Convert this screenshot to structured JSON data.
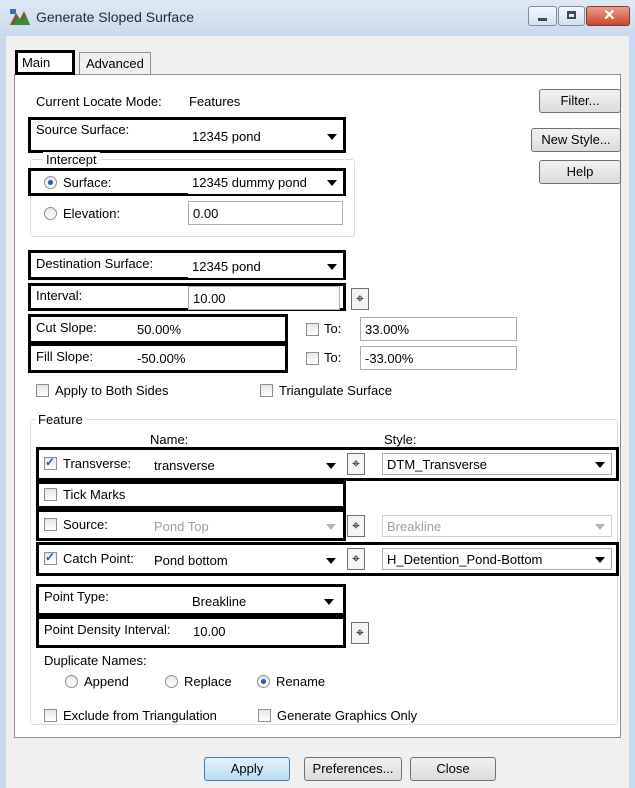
{
  "window": {
    "title": "Generate Sloped Surface"
  },
  "tabs": [
    {
      "label": "Main"
    },
    {
      "label": "Advanced"
    }
  ],
  "locate": {
    "label": "Current Locate Mode:",
    "value": "Features"
  },
  "source_surface": {
    "label": "Source Surface:",
    "value": "12345 pond"
  },
  "intercept": {
    "group_label": "Intercept",
    "surface_label": "Surface:",
    "surface_value": "12345 dummy pond",
    "elevation_label": "Elevation:",
    "elevation_value": "0.00"
  },
  "destination_surface": {
    "label": "Destination Surface:",
    "value": "12345 pond"
  },
  "interval": {
    "label": "Interval:",
    "value": "10.00"
  },
  "cut_slope": {
    "label": "Cut Slope:",
    "value": "50.00%",
    "to_label": "To:",
    "to_value": "33.00%"
  },
  "fill_slope": {
    "label": "Fill Slope:",
    "value": "-50.00%",
    "to_label": "To:",
    "to_value": "-33.00%"
  },
  "options": {
    "apply_both_sides": "Apply to Both Sides",
    "triangulate_surface": "Triangulate Surface"
  },
  "feature": {
    "group_label": "Feature",
    "name_header": "Name:",
    "style_header": "Style:",
    "transverse": {
      "label": "Transverse:",
      "name": "transverse",
      "style": "DTM_Transverse",
      "checked": true
    },
    "tick_marks": {
      "label": "Tick Marks",
      "checked": false
    },
    "source": {
      "label": "Source:",
      "name": "Pond Top",
      "style": "Breakline",
      "checked": false
    },
    "catch_point": {
      "label": "Catch Point:",
      "name": "Pond bottom",
      "style": "H_Detention_Pond-Bottom",
      "checked": true
    },
    "point_type": {
      "label": "Point Type:",
      "value": "Breakline"
    },
    "point_density": {
      "label": "Point Density Interval:",
      "value": "10.00"
    },
    "duplicate_names": {
      "label": "Duplicate Names:",
      "append": "Append",
      "replace": "Replace",
      "rename": "Rename",
      "selected": "Rename"
    },
    "exclude_triangulation": "Exclude from Triangulation",
    "graphics_only": "Generate Graphics Only"
  },
  "side_buttons": {
    "filter": "Filter...",
    "new_style": "New Style...",
    "help": "Help"
  },
  "bottom_buttons": {
    "apply": "Apply",
    "preferences": "Preferences...",
    "close": "Close"
  },
  "icons": {
    "picker": "⌖",
    "app": "sloped-surface-icon"
  },
  "colors": {
    "title_bar": "#c9d9ee",
    "close_button": "#c7452c",
    "highlight_border": "#000000"
  }
}
